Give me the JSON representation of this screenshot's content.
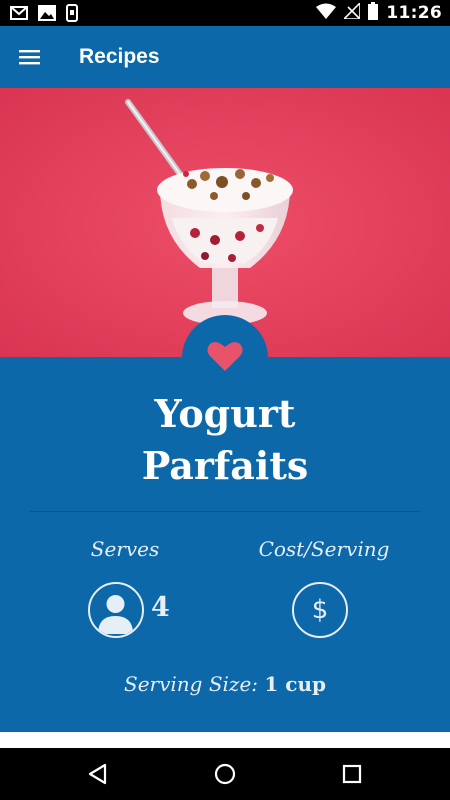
{
  "status_bar": {
    "time": "11:26",
    "left_icons": [
      "gmail-icon",
      "photos-icon",
      "app-notification-icon"
    ],
    "right_icons": [
      "wifi-icon",
      "no-signal-icon",
      "battery-icon"
    ]
  },
  "app_bar": {
    "title": "Recipes",
    "menu_icon": "hamburger-menu-icon"
  },
  "hero": {
    "subject": "yogurt parfait in glass with spoon"
  },
  "recipe": {
    "title_line1": "Yogurt",
    "title_line2": "Parfaits",
    "favorite_icon": "heart-icon",
    "serves_label": "Serves",
    "serves_value": "4",
    "cost_label": "Cost/Serving",
    "cost_symbol": "$",
    "serving_size_label": "Serving Size:",
    "serving_size_value": "1 cup"
  },
  "nav_bar": {
    "buttons": [
      "back-icon",
      "home-icon",
      "recents-icon"
    ]
  },
  "colors": {
    "primary": "#0c68a8",
    "accent_heart": "#e8526a",
    "hero_background": "#e84560"
  }
}
